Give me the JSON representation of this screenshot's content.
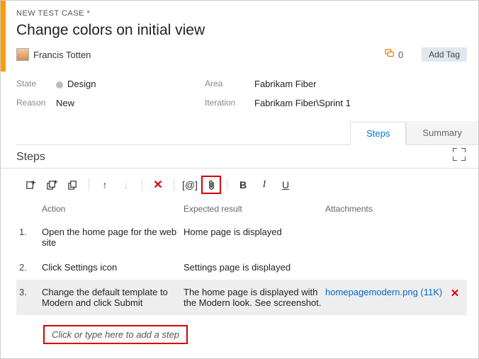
{
  "header": {
    "crumb": "NEW TEST CASE *",
    "title": "Change colors on initial view",
    "user": "Francis Totten",
    "discussion_count": "0",
    "add_tag": "Add Tag"
  },
  "meta": {
    "state_label": "State",
    "state_value": "Design",
    "reason_label": "Reason",
    "reason_value": "New",
    "area_label": "Area",
    "area_value": "Fabrikam Fiber",
    "iteration_label": "Iteration",
    "iteration_value": "Fabrikam Fiber\\Sprint 1"
  },
  "tabs": {
    "steps": "Steps",
    "summary": "Summary"
  },
  "section": {
    "title": "Steps"
  },
  "columns": {
    "action": "Action",
    "expected": "Expected result",
    "attachments": "Attachments"
  },
  "steps": [
    {
      "num": "1.",
      "action": "Open the home page for the web site",
      "expected": "Home page is displayed",
      "attachment": ""
    },
    {
      "num": "2.",
      "action": "Click Settings icon",
      "expected": "Settings page is displayed",
      "attachment": ""
    },
    {
      "num": "3.",
      "action": "Change the default template to Modern and click Submit",
      "expected": "The home page is displayed with the Modern look. See screenshot.",
      "attachment": "homepagemodern.png (11K)"
    }
  ],
  "addstep": "Click or type here to add a step",
  "icons": {
    "param": "[@]",
    "bold": "B",
    "italic": "I",
    "underline": "U",
    "delete": "✕",
    "rowdelete": "✕"
  }
}
